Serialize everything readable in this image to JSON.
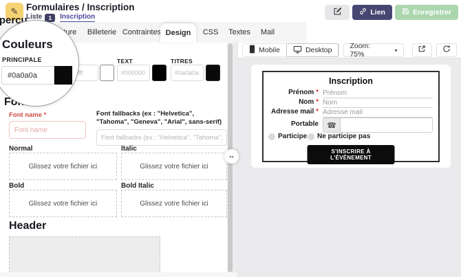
{
  "header": {
    "title": "Formulaires / Inscription",
    "nav": {
      "liste_label": "Liste",
      "liste_badge": "1",
      "inscription_label": "Inscription"
    },
    "actions": {
      "lien_label": "Lien",
      "save_label": "Enregistrer"
    }
  },
  "tabs": [
    {
      "label": "Structure",
      "active": false
    },
    {
      "label": "Billeterie",
      "active": false
    },
    {
      "label": "Contraintes",
      "active": false
    },
    {
      "label": "Design",
      "active": true
    },
    {
      "label": "CSS",
      "active": false
    },
    {
      "label": "Textes",
      "active": false
    },
    {
      "label": "Mail",
      "active": false
    }
  ],
  "left_panel": {
    "apercu_heading": "Aperçu",
    "colors": {
      "heading": "Couleurs",
      "principale": {
        "label": "PRINCIPALE",
        "value": "#0a0a0a",
        "swatch": "#0a0a0a"
      },
      "secondaire": {
        "placeholder": "#ffffff",
        "swatch": "#ffffff"
      },
      "text": {
        "label": "TEXT",
        "placeholder": "#000000",
        "swatch": "#000000"
      },
      "titres": {
        "label": "TITRES",
        "placeholder": "#0a0a0a",
        "swatch": "#0a0a0a"
      }
    },
    "fonts": {
      "heading": "Fonts",
      "required_marker": "*",
      "font_name_label": "Font name",
      "font_name_placeholder": "Font name",
      "fallbacks_label": "Font fallbacks (ex : \"Helvetica\", \"Tahoma\", \"Geneva\", \"Arial\", sans-serif)",
      "fallbacks_placeholder": "Font fallbacks (ex : \"Helvetica\", \"Tahoma\", \"Geneva\", \"Arial\", sans-serif)",
      "dropzone_text": "Glissez votre fichier ici",
      "variants": [
        {
          "label": "Normal"
        },
        {
          "label": "Italic"
        },
        {
          "label": "Bold"
        },
        {
          "label": "Bold Italic"
        }
      ]
    },
    "header_section": {
      "heading": "Header"
    }
  },
  "splitter": {
    "left_glyph": "◂",
    "right_glyph": "▸"
  },
  "preview": {
    "toolbar": {
      "mobile_label": "Mobile",
      "desktop_label": "Desktop",
      "zoom_label": "Zoom: 75%",
      "caret": "▾"
    },
    "form": {
      "title": "Inscription",
      "required_marker": "*",
      "fields": [
        {
          "label": "Prénom",
          "placeholder": "Prénom"
        },
        {
          "label": "Nom",
          "placeholder": "Nom"
        },
        {
          "label": "Adresse mail",
          "placeholder": "Adresse mail"
        },
        {
          "label": "Portable",
          "placeholder": ""
        }
      ],
      "phone_icon_glyph": "☎",
      "radios": [
        {
          "label": "Participe"
        },
        {
          "label": "Ne participe pas"
        }
      ],
      "submit_label": "S'INSCRIRE À L'ÉVÉNEMENT"
    }
  },
  "ui_colors": {
    "accent_purple": "#4c459c",
    "badge_navy": "#3f3f63",
    "lien_button": "#474672",
    "save_button_green": "#abd6ae",
    "pencil_badge_yellow": "#f6d274",
    "required_red": "#cb4a42",
    "preview_submit_black": "#0c0c0c"
  }
}
